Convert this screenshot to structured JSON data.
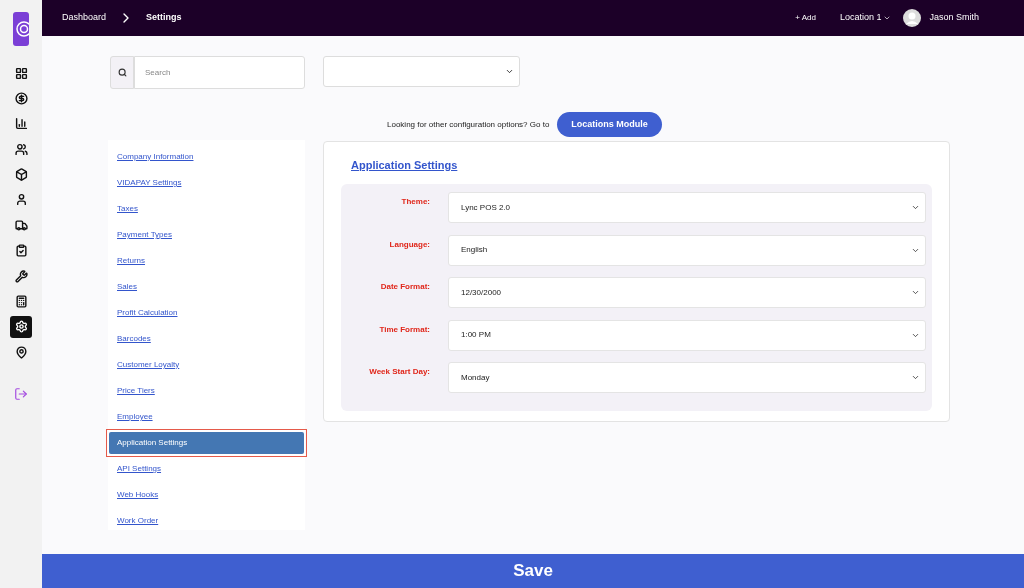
{
  "sidebar": {
    "items": [
      {
        "kind": "grid",
        "selected": false
      },
      {
        "kind": "dollar",
        "selected": false
      },
      {
        "kind": "chart",
        "selected": false
      },
      {
        "kind": "users",
        "selected": false
      },
      {
        "kind": "box",
        "selected": false
      },
      {
        "kind": "user",
        "selected": false
      },
      {
        "kind": "dolly",
        "selected": false
      },
      {
        "kind": "clipboard",
        "selected": false
      },
      {
        "kind": "tools",
        "selected": false
      },
      {
        "kind": "register",
        "selected": false
      },
      {
        "kind": "gear",
        "selected": true
      },
      {
        "kind": "pin",
        "selected": false
      }
    ]
  },
  "topbar": {
    "breadcrumb": [
      "Dashboard",
      "Settings"
    ],
    "add": "+ Add",
    "location": "Location 1",
    "user": "Jason Smith"
  },
  "search": {
    "placeholder": "Search"
  },
  "notice": {
    "text": "Looking for other configuration options? Go to",
    "button": "Locations Module"
  },
  "menu": [
    {
      "label": "Company Information",
      "selected": false
    },
    {
      "label": "VIDAPAY Settings",
      "selected": false
    },
    {
      "label": "Taxes",
      "selected": false
    },
    {
      "label": "Payment Types",
      "selected": false
    },
    {
      "label": "Returns",
      "selected": false
    },
    {
      "label": "Sales",
      "selected": false
    },
    {
      "label": "Profit Calculation",
      "selected": false
    },
    {
      "label": "Barcodes",
      "selected": false
    },
    {
      "label": "Customer Loyalty",
      "selected": false
    },
    {
      "label": "Price Tiers",
      "selected": false
    },
    {
      "label": "Employee",
      "selected": false
    },
    {
      "label": "Application Settings",
      "selected": true
    },
    {
      "label": "API Settings",
      "selected": false
    },
    {
      "label": "Web Hooks",
      "selected": false
    },
    {
      "label": "Work Order",
      "selected": false
    }
  ],
  "panel": {
    "title": "Application Settings",
    "fields": [
      {
        "label": "Theme:",
        "value": "Lync POS 2.0"
      },
      {
        "label": "Language:",
        "value": "English"
      },
      {
        "label": "Date Format:",
        "value": "12/30/2000"
      },
      {
        "label": "Time Format:",
        "value": "1:00 PM"
      },
      {
        "label": "Week Start Day:",
        "value": "Monday"
      }
    ]
  },
  "save_button": "Save"
}
